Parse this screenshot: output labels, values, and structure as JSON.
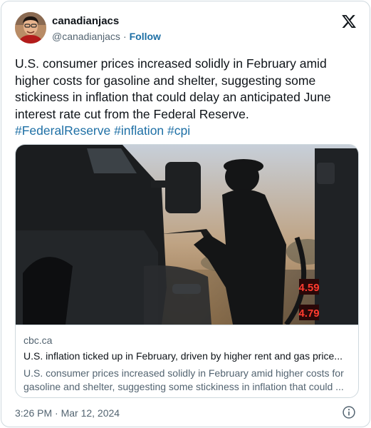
{
  "author": {
    "display_name": "canadianjacs",
    "handle": "@canadianjacs",
    "separator": "·",
    "follow_label": "Follow"
  },
  "tweet": {
    "text": "U.S. consumer prices increased solidly in February amid higher costs for gasoline and shelter, suggesting some stickiness in inflation that could delay an anticipated June interest rate cut from the Federal Reserve.",
    "hashtags": [
      "#FederalReserve",
      "#inflation",
      "#cpi"
    ]
  },
  "card": {
    "domain": "cbc.ca",
    "title": "U.S. inflation ticked up in February, driven by higher rent and gas price...",
    "description": "U.S. consumer prices increased solidly in February amid higher costs for gasoline and shelter, suggesting some stickiness in inflation that could ...",
    "pump_price_top": "4.59",
    "pump_price_bottom": "4.79"
  },
  "footer": {
    "timestamp": "3:26 PM · Mar 12, 2024"
  },
  "icons": {
    "brand": "x-logo-icon",
    "info": "info-icon"
  },
  "colors": {
    "text": "#0f1419",
    "secondary": "#536471",
    "link": "#1d6fa5",
    "border": "#cfd9de"
  }
}
